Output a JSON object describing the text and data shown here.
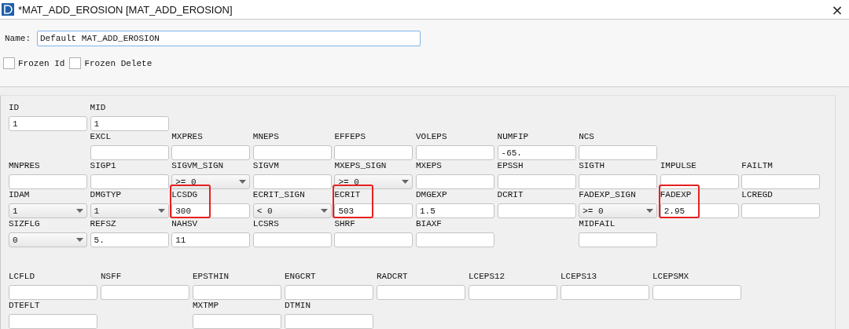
{
  "window": {
    "title": "*MAT_ADD_EROSION [MAT_ADD_EROSION]",
    "close": "×"
  },
  "header": {
    "name_label": "Name:",
    "name_value": "Default MAT_ADD_EROSION",
    "checkboxes": [
      {
        "label": "Frozen Id",
        "checked": false
      },
      {
        "label": "Frozen Delete",
        "checked": false
      }
    ]
  },
  "card_rows": [
    [
      {
        "label": "ID",
        "kind": "input",
        "value": "1",
        "highlighted": false
      },
      {
        "label": "MID",
        "kind": "input",
        "value": "1",
        "highlighted": false
      }
    ],
    [
      {
        "label": "EXCL",
        "kind": "input",
        "highlighted": false
      },
      {
        "label": "MXPRES",
        "kind": "input",
        "highlighted": false
      },
      {
        "label": "MNEPS",
        "kind": "input",
        "highlighted": false
      },
      {
        "label": "EFFEPS",
        "kind": "input",
        "highlighted": false
      },
      {
        "label": "VOLEPS",
        "kind": "input",
        "highlighted": false
      },
      {
        "label": "NUMFIP",
        "kind": "input",
        "value": "-65.",
        "highlighted": false
      },
      {
        "label": "NCS",
        "kind": "input",
        "highlighted": false
      }
    ],
    [
      {
        "label": "MNPRES",
        "kind": "input",
        "highlighted": false
      },
      {
        "label": "SIGP1",
        "kind": "input",
        "highlighted": false
      },
      {
        "label": "SIGVM_SIGN",
        "kind": "select",
        "value": ">= 0",
        "highlighted": false
      },
      {
        "label": "SIGVM",
        "kind": "input",
        "highlighted": false
      },
      {
        "label": "MXEPS_SIGN",
        "kind": "select",
        "value": ">= 0",
        "highlighted": false
      },
      {
        "label": "MXEPS",
        "kind": "input",
        "highlighted": false
      },
      {
        "label": "EPSSH",
        "kind": "input",
        "highlighted": false
      },
      {
        "label": "SIGTH",
        "kind": "input",
        "highlighted": false
      },
      {
        "label": "IMPULSE",
        "kind": "input",
        "highlighted": false
      },
      {
        "label": "FAILTM",
        "kind": "input",
        "highlighted": false
      }
    ],
    [
      {
        "label": "IDAM",
        "kind": "select",
        "value": "1",
        "highlighted": false
      },
      {
        "label": "DMGTYP",
        "kind": "select",
        "value": "1",
        "highlighted": false
      },
      {
        "label": "LCSDG",
        "kind": "input",
        "value": "300",
        "highlighted": true
      },
      {
        "label": "ECRIT_SIGN",
        "kind": "select",
        "value": "< 0",
        "highlighted": false
      },
      {
        "label": "ECRIT",
        "kind": "input",
        "value": "503",
        "highlighted": true
      },
      {
        "label": "DMGEXP",
        "kind": "input",
        "value": "1.5",
        "highlighted": false
      },
      {
        "label": "DCRIT",
        "kind": "input",
        "highlighted": false
      },
      {
        "label": "FADEXP_SIGN",
        "kind": "select",
        "value": ">= 0",
        "highlighted": false
      },
      {
        "label": "FADEXP",
        "kind": "input",
        "value": "2.95",
        "highlighted": true
      },
      {
        "label": "LCREGD",
        "kind": "input",
        "highlighted": false
      }
    ],
    [
      {
        "label": "SIZFLG",
        "kind": "select",
        "value": "0",
        "highlighted": false
      },
      {
        "label": "REFSZ",
        "kind": "input",
        "value": "5.",
        "highlighted": false
      },
      {
        "label": "NAHSV",
        "kind": "input",
        "value": "11",
        "highlighted": false
      },
      {
        "label": "LCSRS",
        "kind": "input",
        "highlighted": false
      },
      {
        "label": "SHRF",
        "kind": "input",
        "highlighted": false
      },
      {
        "label": "BIAXF",
        "kind": "input",
        "highlighted": false
      },
      {
        "label": "MIDFAIL",
        "kind": "input",
        "highlighted": false
      }
    ]
  ],
  "extra_rows": [
    [
      {
        "label": "LCFLD",
        "kind": "input",
        "highlighted": false
      },
      {
        "label": "NSFF",
        "kind": "input",
        "highlighted": false
      },
      {
        "label": "EPSTHIN",
        "kind": "input",
        "highlighted": false
      },
      {
        "label": "ENGCRT",
        "kind": "input",
        "highlighted": false
      },
      {
        "label": "RADCRT",
        "kind": "input",
        "highlighted": false
      },
      {
        "label": "LCEPS12",
        "kind": "input",
        "highlighted": false
      },
      {
        "label": "LCEPS13",
        "kind": "input",
        "highlighted": false
      },
      {
        "label": "LCEPSMX",
        "kind": "input",
        "highlighted": false
      }
    ],
    [
      {
        "label": "DTEFLT",
        "kind": "input",
        "highlighted": false
      },
      {
        "label": "MXTMP",
        "kind": "input",
        "highlighted": false
      },
      {
        "label": "DTMIN",
        "kind": "input",
        "highlighted": false
      }
    ]
  ]
}
